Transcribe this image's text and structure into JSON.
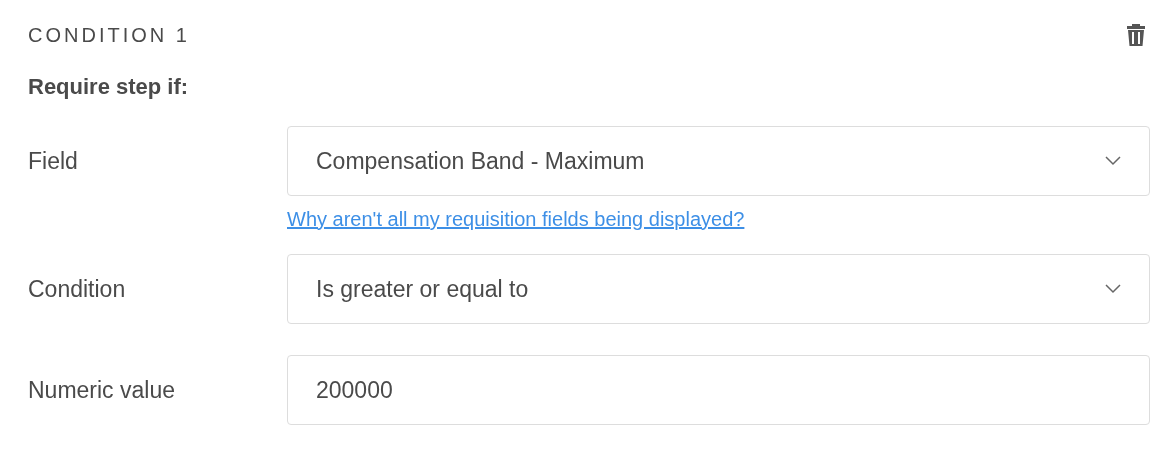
{
  "header": {
    "title": "CONDITION 1"
  },
  "subtitle": "Require step if:",
  "rows": [
    {
      "kind": "select",
      "label": "Field",
      "value": "Compensation Band - Maximum",
      "help_link": "Why aren't all my requisition fields being displayed?"
    },
    {
      "kind": "select",
      "label": "Condition",
      "value": "Is greater or equal to"
    },
    {
      "kind": "input",
      "label": "Numeric value",
      "value": "200000"
    }
  ]
}
